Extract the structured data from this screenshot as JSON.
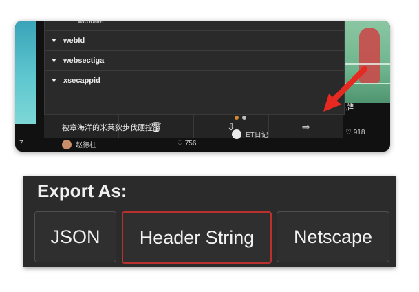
{
  "menu": {
    "cut_label": "webdata",
    "items": [
      {
        "label": "webId"
      },
      {
        "label": "websectiga"
      },
      {
        "label": "xsecappid"
      }
    ]
  },
  "toolbar": {
    "add": "+",
    "delete": "🗑",
    "import": "⇩",
    "export": "⇨"
  },
  "feed": {
    "caption": "被章海洋的米莱狄步伐硬控了",
    "author": "赵德柱",
    "likes_1": "♡ 756",
    "source_2": "ET日记",
    "likes_2": "♡ 918",
    "right_caption": "限牌",
    "left_number": "7"
  },
  "export_panel": {
    "title": "Export As:",
    "buttons": [
      {
        "label": "JSON"
      },
      {
        "label": "Header String",
        "selected": true
      },
      {
        "label": "Netscape"
      }
    ]
  },
  "colors": {
    "panel_bg": "#111111",
    "menu_bg": "#2a2a2a",
    "export_bg": "#2b2b2b",
    "selected_border": "#b8312f",
    "arrow": "#e62a21"
  }
}
